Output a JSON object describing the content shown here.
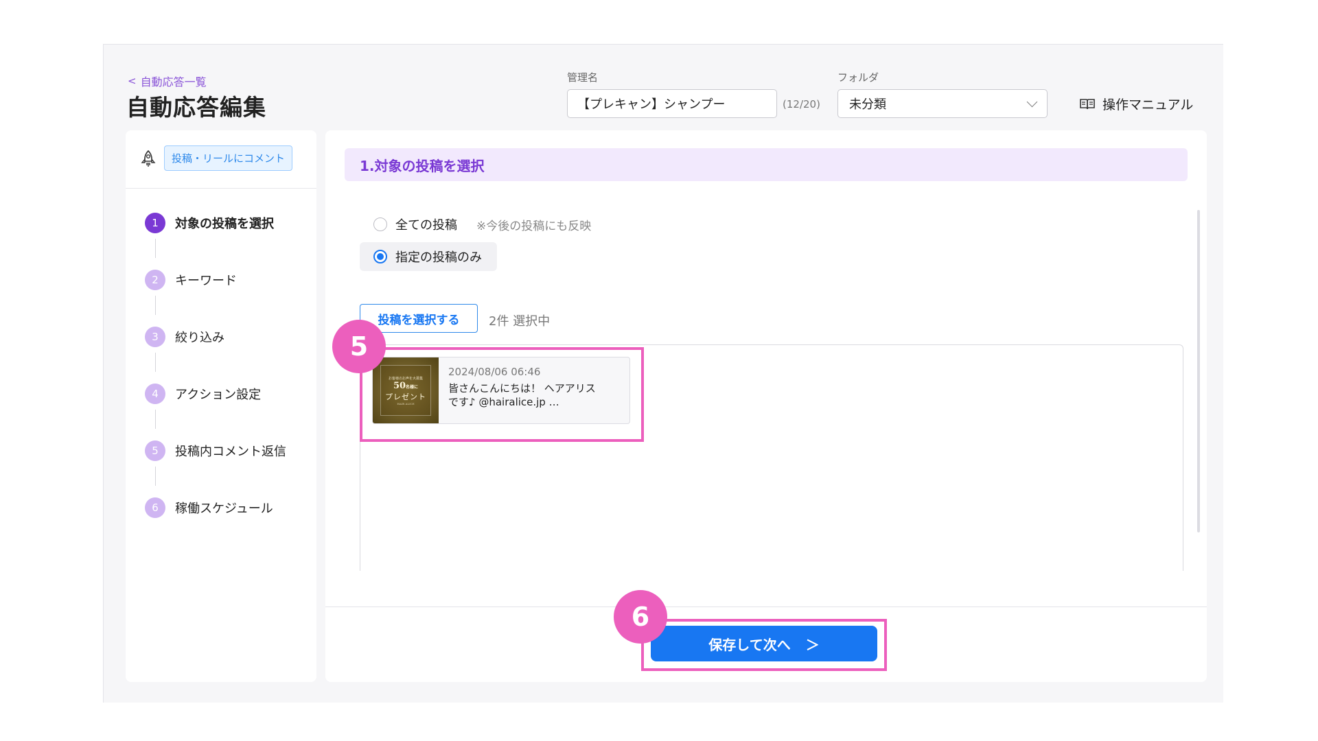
{
  "header": {
    "back_label": "自動応答一覧",
    "page_title": "自動応答編集",
    "name_label": "管理名",
    "name_value": "【プレキャン】シャンプー",
    "name_counter": "(12/20)",
    "folder_label": "フォルダ",
    "folder_value": "未分類",
    "manual_label": "操作マニュアル"
  },
  "sidebar": {
    "trigger_badge": "投稿・リールにコメント",
    "steps": [
      {
        "num": "1",
        "label": "対象の投稿を選択"
      },
      {
        "num": "2",
        "label": "キーワード"
      },
      {
        "num": "3",
        "label": "絞り込み"
      },
      {
        "num": "4",
        "label": "アクション設定"
      },
      {
        "num": "5",
        "label": "投稿内コメント返信"
      },
      {
        "num": "6",
        "label": "稼働スケジュール"
      }
    ]
  },
  "main": {
    "section_title": "1.対象の投稿を選択",
    "radio_all_label": "全ての投稿",
    "radio_all_note": "※今後の投稿にも反映",
    "radio_specific_label": "指定の投稿のみ",
    "select_button": "投稿を選択する",
    "selected_count": "2件 選択中",
    "post": {
      "date": "2024/08/06 06:46",
      "caption": "皆さんこんにちは！ ヘアアリスです♪ @hairalice.jp …",
      "thumb_top": "お客様のお声を大募集",
      "thumb_num": "50",
      "thumb_num_suffix": "名様に",
      "thumb_main": "プレゼント",
      "thumb_bottom": "HAIR ALICE"
    },
    "save_button": "保存して次へ",
    "save_chevron": "＞"
  },
  "annotations": {
    "callout_post": "5",
    "callout_save": "6",
    "highlight_color": "#ec5fbd"
  },
  "colors": {
    "accent_purple": "#7a39d4",
    "primary_blue": "#1877f2"
  }
}
